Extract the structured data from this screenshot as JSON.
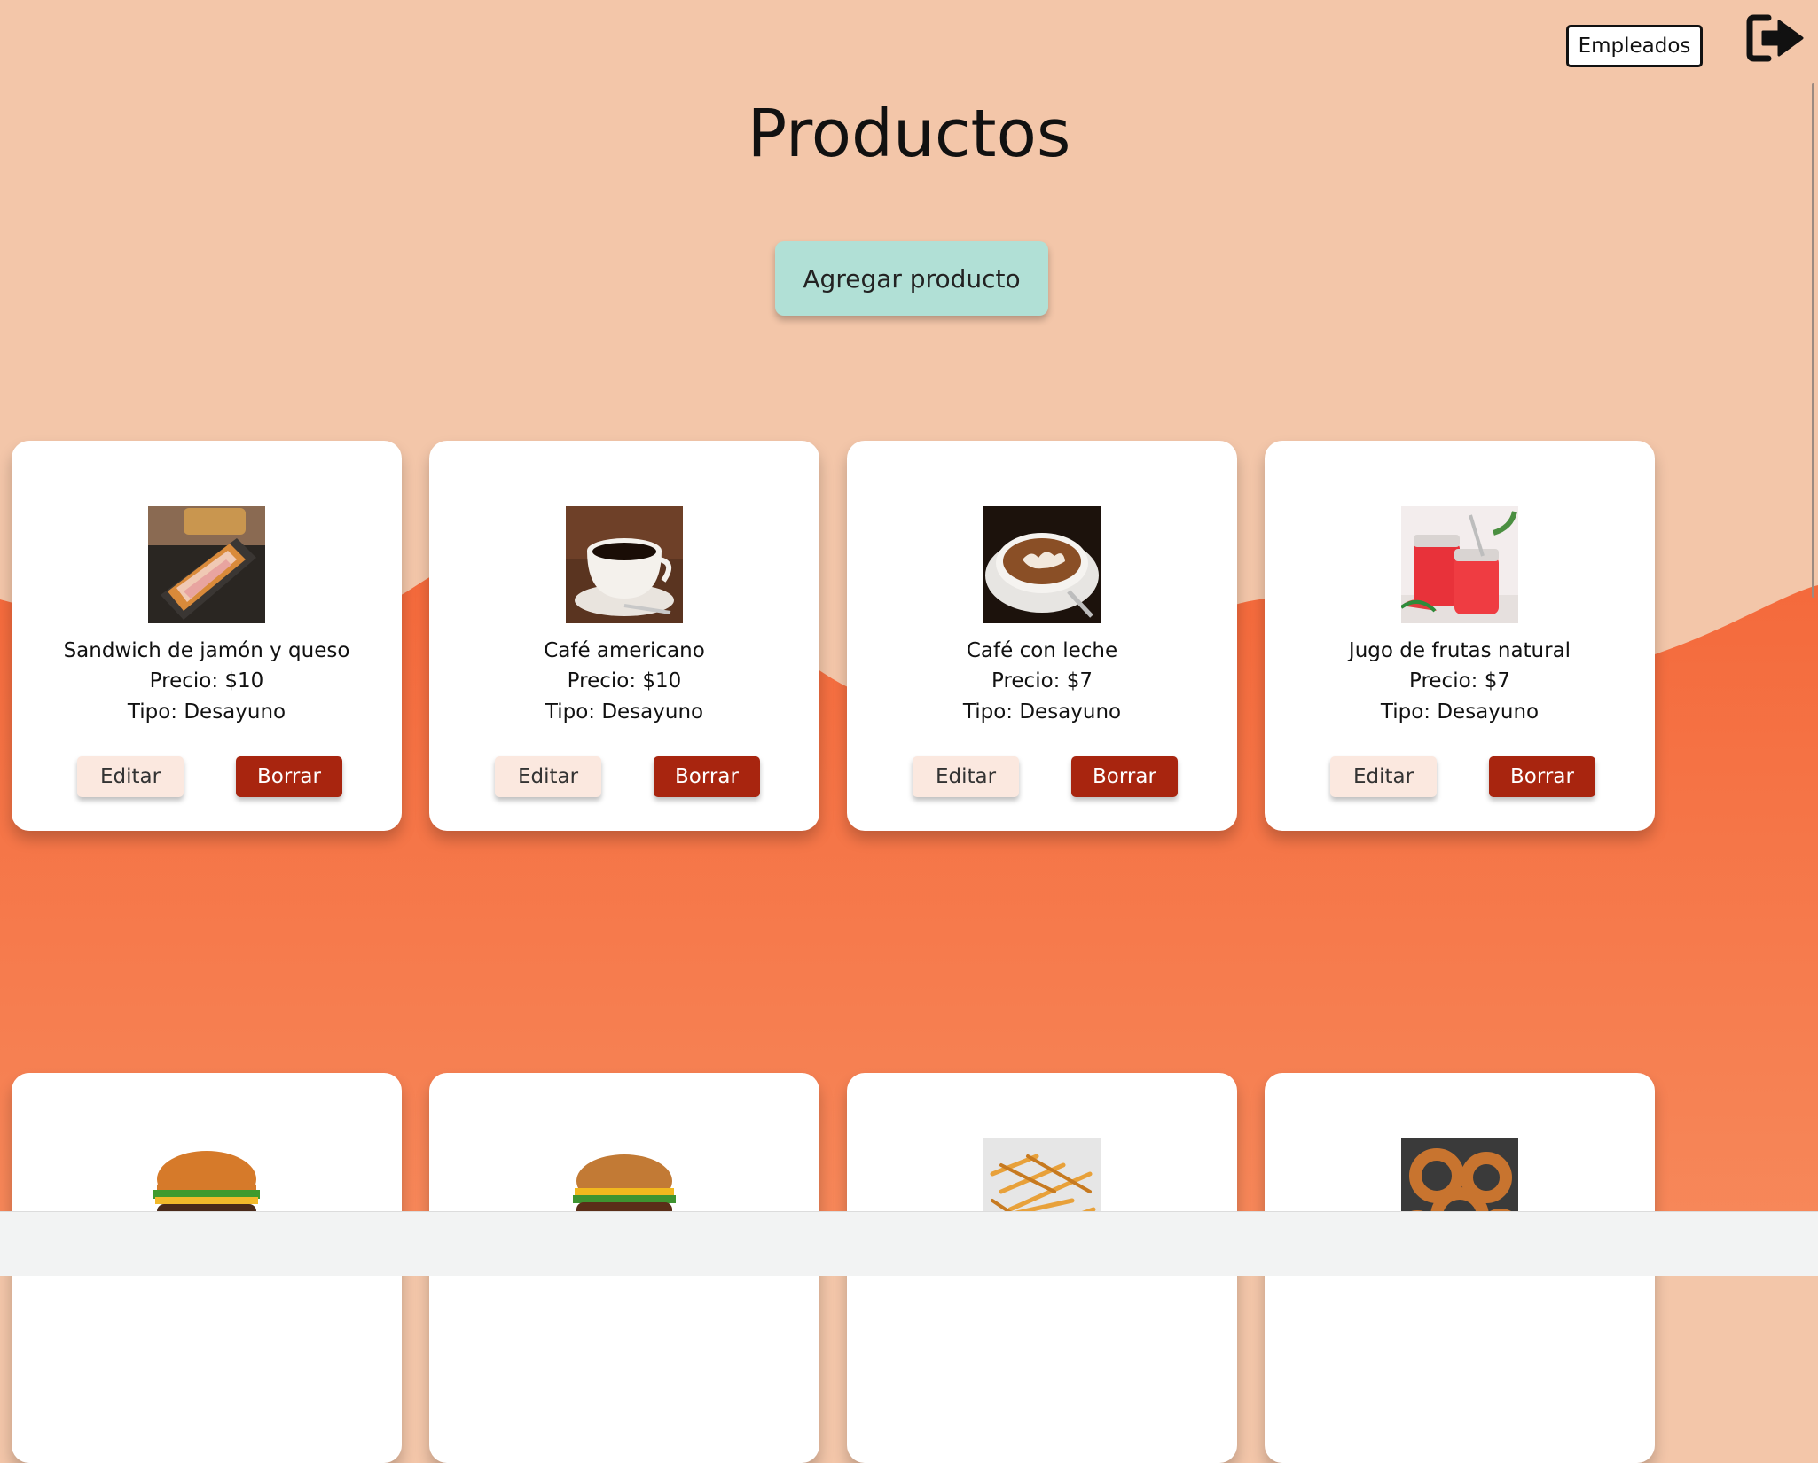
{
  "header": {
    "employees_label": "Empleados"
  },
  "page": {
    "title": "Productos",
    "add_button": "Agregar producto"
  },
  "colors": {
    "top_bg": "#f3c6a9",
    "wave": "#f5713d",
    "add_button": "#b1e0d6",
    "delete_button": "#a8250f",
    "edit_button": "#fbe8df"
  },
  "products": [
    {
      "name": "Sandwich de jamón y queso",
      "price": "Precio: $10",
      "type": "Tipo: Desayuno",
      "image": "sandwich",
      "edit": "Editar",
      "delete": "Borrar"
    },
    {
      "name": "Café americano",
      "price": "Precio: $10",
      "type": "Tipo: Desayuno",
      "image": "coffee",
      "edit": "Editar",
      "delete": "Borrar"
    },
    {
      "name": "Café con leche",
      "price": "Precio: $7",
      "type": "Tipo: Desayuno",
      "image": "latte",
      "edit": "Editar",
      "delete": "Borrar"
    },
    {
      "name": "Jugo de frutas natural",
      "price": "Precio: $7",
      "type": "Tipo: Desayuno",
      "image": "juice",
      "edit": "Editar",
      "delete": "Borrar"
    },
    {
      "image": "burger"
    },
    {
      "image": "burger2"
    },
    {
      "image": "fries"
    },
    {
      "image": "onion-rings"
    }
  ]
}
